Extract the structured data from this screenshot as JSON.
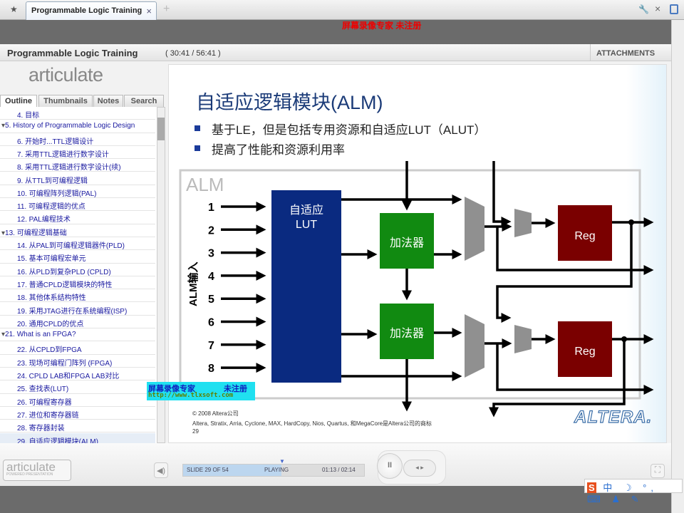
{
  "browser": {
    "tab_title": "Programmable Logic Training",
    "tab_close": "×",
    "new_tab": "+",
    "star": "★",
    "tools": "wrench-icon",
    "close": "×"
  },
  "watermark": {
    "top": "屏幕录像专家 未注册",
    "box_line1": "屏幕录像专家",
    "box_line2": "未注册",
    "box_url": "http://www.tlxsoft.com"
  },
  "player": {
    "title": "Programmable Logic Training",
    "time": "( 30:41 / 56:41 )",
    "attachments": "ATTACHMENTS",
    "logo": "articulate",
    "logo_bottom": "articulate",
    "logo_bottom_sub": "POWERED PRESENTATION"
  },
  "sidebar": {
    "tabs": [
      {
        "label": "Outline",
        "active": true
      },
      {
        "label": "Thumbnails"
      },
      {
        "label": "Notes"
      },
      {
        "label": "Search"
      }
    ],
    "items": [
      {
        "label": "4. 目标",
        "level": 1
      },
      {
        "label": "5. History of Programmable Logic Design",
        "level": 0,
        "expanded": true
      },
      {
        "label": "6. 开始时...TTL逻辑设计",
        "level": 1
      },
      {
        "label": "7. 采用TTL逻辑进行数字设计",
        "level": 1
      },
      {
        "label": "8. 采用TTL逻辑进行数字设计(续)",
        "level": 1
      },
      {
        "label": "9. 从TTL到可编程逻辑",
        "level": 1
      },
      {
        "label": "10. 可编程阵列逻辑(PAL)",
        "level": 1
      },
      {
        "label": "11. 可编程逻辑的优点",
        "level": 1
      },
      {
        "label": "12. PAL编程技术",
        "level": 1
      },
      {
        "label": "13. 可编程逻辑基础",
        "level": 0,
        "expanded": true
      },
      {
        "label": "14. 从PAL到可编程逻辑器件(PLD)",
        "level": 1
      },
      {
        "label": "15. 基本可编程宏单元",
        "level": 1
      },
      {
        "label": "16. 从PLD到复杂PLD (CPLD)",
        "level": 1
      },
      {
        "label": "17. 普通CPLD逻辑模块的特性",
        "level": 1
      },
      {
        "label": "18. 其他体系结构特性",
        "level": 1
      },
      {
        "label": "19. 采用JTAG进行在系统编程(ISP)",
        "level": 1
      },
      {
        "label": "20. 通用CPLD的优点",
        "level": 1
      },
      {
        "label": "21. What is an FPGA?",
        "level": 0,
        "expanded": true
      },
      {
        "label": "22. 从CPLD到FPGA",
        "level": 1
      },
      {
        "label": "23. 现场可编程门阵列 (FPGA)",
        "level": 1
      },
      {
        "label": "24. CPLD LAB和FPGA LAB对比",
        "level": 1
      },
      {
        "label": "25. 查找表(LUT)",
        "level": 1
      },
      {
        "label": "26. 可编程寄存器",
        "level": 1
      },
      {
        "label": "27. 进位和寄存器链",
        "level": 1
      },
      {
        "label": "28. 寄存器封装",
        "level": 1
      },
      {
        "label": "29. 自适应逻辑模块(ALM)",
        "level": 1,
        "selected": true
      }
    ]
  },
  "slide": {
    "title": "自适应逻辑模块(ALM)",
    "bullets": [
      "基于LE，但是包括专用资源和自适应LUT（ALUT）",
      "提高了性能和资源利用率"
    ],
    "diagram": {
      "box_label": "ALM",
      "inputs_label": "ALM输入",
      "inputs": [
        "1",
        "2",
        "3",
        "4",
        "5",
        "6",
        "7",
        "8"
      ],
      "lut_line1": "自适应",
      "lut_line2": "LUT",
      "adder": "加法器",
      "reg": "Reg"
    },
    "footer_copyright": "© 2008 Altera公司",
    "footer_trademark": "Altera, Stratix, Arria, Cyclone, MAX, HardCopy, Nios, Quartus, 和MegaCore是Altera公司的商标",
    "page_number": "29",
    "brand": "ALTERA.",
    "colors": {
      "title": "#1b3b78",
      "lut": "#0a2a80",
      "adder": "#118a11",
      "reg": "#7a0000"
    }
  },
  "controls": {
    "slide_status": "SLIDE 29 OF 54",
    "state": "PLAYING",
    "elapsed": "01:13 / 02:14",
    "progress": 0.545,
    "pause": "II",
    "prev_next": "◂ ▸",
    "volume": "◀)",
    "fullscreen": "⛶"
  },
  "ime": {
    "logo": "S",
    "items": "中 ☽ °, ⌨ ♟ ✎"
  }
}
